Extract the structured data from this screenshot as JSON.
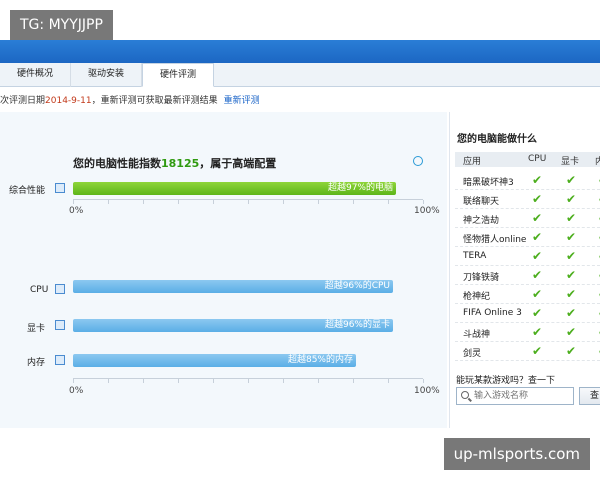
{
  "watermarks": {
    "top": "TG: MYYJJPP",
    "bottom": "up-mlsports.com"
  },
  "tabs": [
    {
      "label": "硬件概况",
      "active": false
    },
    {
      "label": "驱动安装",
      "active": false
    },
    {
      "label": "硬件评测",
      "active": true
    }
  ],
  "info": {
    "prefix": "次评测日期",
    "date": "2014-9-11",
    "suffix": "，重新评测可获取最新评测结果",
    "relink": "重新评测"
  },
  "score": {
    "before": "您的电脑性能指数",
    "value": "18125",
    "after": "，属于高端配置"
  },
  "overall": {
    "label": "综合性能",
    "percent": 97,
    "text": "超越97%的电脑"
  },
  "components": [
    {
      "label": "CPU",
      "percent": 96,
      "text": "超越96%的CPU"
    },
    {
      "label": "显卡",
      "percent": 96,
      "text": "超越96%的显卡"
    },
    {
      "label": "内存",
      "percent": 85,
      "text": "超越85%的内存"
    }
  ],
  "axis": {
    "start": "0%",
    "end": "100%"
  },
  "side": {
    "title": "您的电脑能做什么",
    "columns": [
      "应用",
      "CPU",
      "显卡",
      "内"
    ],
    "games": [
      {
        "name": "暗黑破坏神3"
      },
      {
        "name": "联络聊天"
      },
      {
        "name": "神之浩劫"
      },
      {
        "name": "怪物猎人online"
      },
      {
        "name": "TERA"
      },
      {
        "name": "刀锋铁骑"
      },
      {
        "name": "枪神纪"
      },
      {
        "name": "FIFA Online 3"
      },
      {
        "name": "斗战神"
      },
      {
        "name": "剑灵"
      }
    ],
    "check_glyph": "✔",
    "search_question": "能玩某款游戏吗？查一下",
    "search_placeholder": "输入游戏名称",
    "search_button": "查"
  },
  "colors": {
    "titlebar": "#1c67c3",
    "green_bar": "#5db51a",
    "blue_bar": "#5aaee6",
    "score_number": "#2f9a10",
    "date": "#c23a1b",
    "link": "#1a64c8"
  }
}
